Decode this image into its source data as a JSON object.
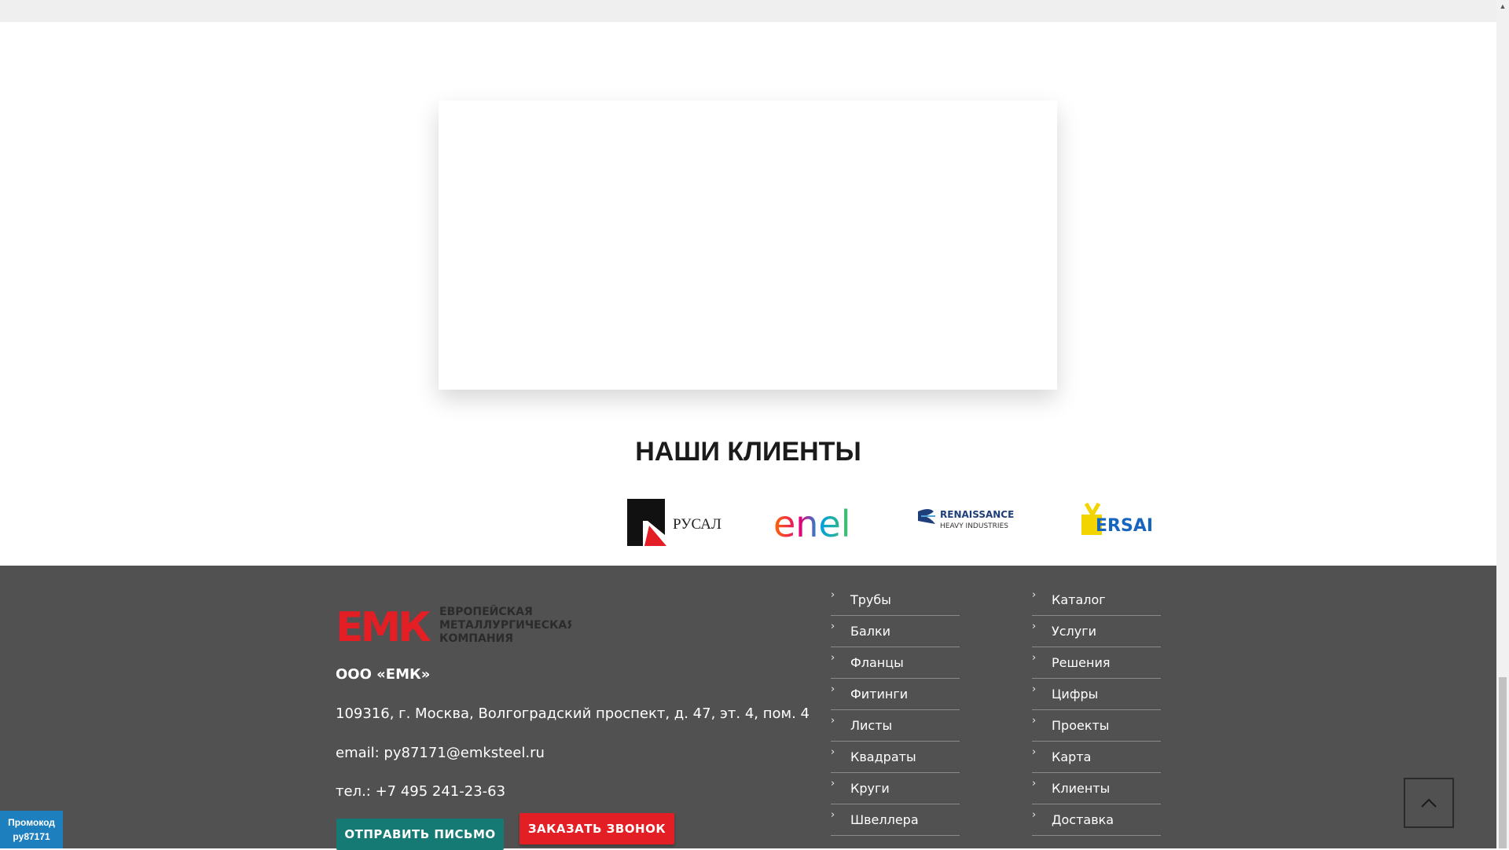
{
  "clients": {
    "heading": "НАШИ КЛИЕНТЫ",
    "logos": [
      {
        "name": "rusal-logo",
        "text": "РУСАЛ"
      },
      {
        "name": "enel-logo",
        "text": "enel"
      },
      {
        "name": "renaissance-logo",
        "text": "RENAISSANCE",
        "subtext": "HEAVY INDUSTRIES"
      },
      {
        "name": "ersai-logo",
        "text": "ERSAI"
      }
    ]
  },
  "footer": {
    "logo": {
      "mark": "ЕМК",
      "line1": "ЕВРОПЕЙСКАЯ",
      "line2": "МЕТАЛЛУРГИЧЕСКАЯ",
      "line3": "КОМПАНИЯ"
    },
    "company_name": "ООО «ЕМК»",
    "address": "109316, г. Москва, Волгоградский проспект, д. 47, эт. 4, пом. 4",
    "email": "email: py87171@emksteel.ru",
    "phone": "тел.: +7 495 241-23-63",
    "btn_letter": "ОТПРАВИТЬ ПИСЬМО",
    "btn_call": "ЗАКАЗАТЬ ЗВОНОК",
    "menu_products": [
      "Трубы",
      "Балки",
      "Фланцы",
      "Фитинги",
      "Листы",
      "Квадраты",
      "Круги",
      "Швеллера"
    ],
    "menu_company": [
      "Каталог",
      "Услуги",
      "Решения",
      "Цифры",
      "Проекты",
      "Карта",
      "Клиенты",
      "Доставка"
    ]
  },
  "promo": {
    "line1": "Промокод",
    "line2": "py87171"
  },
  "colors": {
    "brand_red": "#e31e24",
    "footer_bg": "#515151",
    "teal_button": "#147a73",
    "promo_blue": "#1e7fbf"
  },
  "icons": {
    "menu_bullet": "chevron-right-icon",
    "scroll_top": "chevron-up-icon"
  }
}
